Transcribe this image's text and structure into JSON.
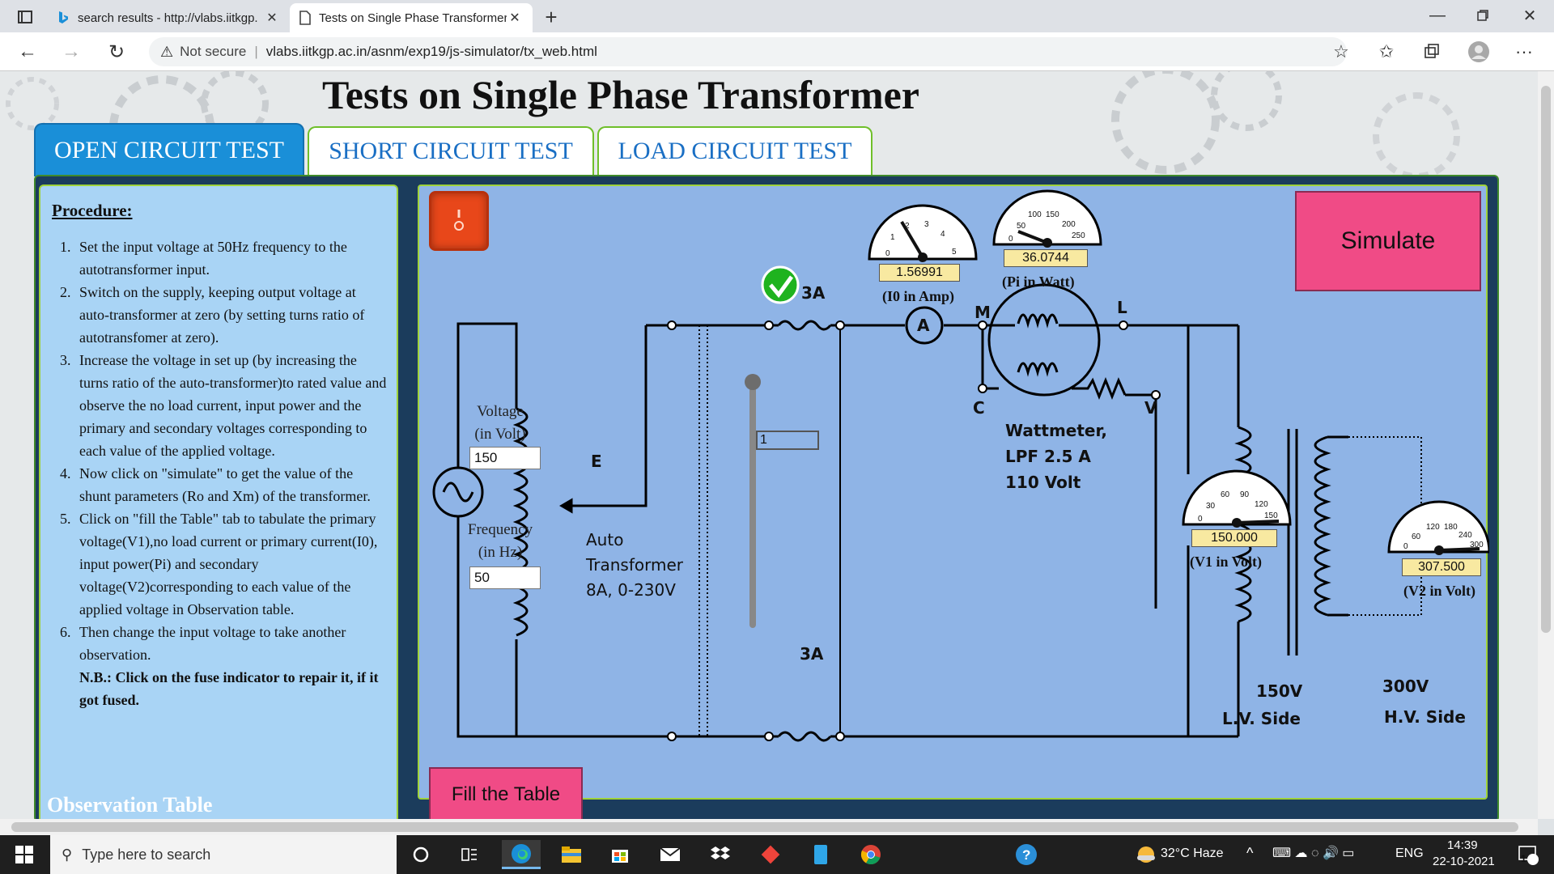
{
  "browser": {
    "tabs": [
      {
        "label": "search results - http://vlabs.iitkgp.",
        "active": false
      },
      {
        "label": "Tests on Single Phase Transformer",
        "active": true
      }
    ],
    "security_label": "Not secure",
    "url": "vlabs.iitkgp.ac.in/asnm/exp19/js-simulator/tx_web.html"
  },
  "page": {
    "title": "Tests on Single Phase Transformer",
    "test_tabs": [
      "OPEN CIRCUIT TEST",
      "SHORT CIRCUIT TEST",
      "LOAD CIRCUIT TEST"
    ],
    "active_test_tab": 0
  },
  "procedure": {
    "heading": "Procedure:",
    "steps": [
      "Set the input voltage at 50Hz frequency to the autotransformer input.",
      "Switch on the supply, keeping output voltage at auto-transformer at zero (by setting turns ratio of autotransfomer at zero).",
      "Increase the voltage in set up (by increasing the turns ratio of the auto-transformer)to rated value and observe the no load current, input power and the primary and secondary voltages corresponding to each value of the applied voltage.",
      "Now click on \"simulate\" to get the value of the shunt parameters (Ro and Xm) of the transformer.",
      "Click on \"fill the Table\" tab to tabulate the primary voltage(V1),no load current or primary current(I0), input power(Pi) and secondary voltage(V2)corresponding to each value of the applied voltage in Observation table.",
      "Then change the input voltage to take another observation."
    ],
    "note": "N.B.: Click on the fuse indicator to repair it, if it got fused."
  },
  "observation_title": "Observation Table",
  "simulator": {
    "simulate_label": "Simulate",
    "fill_table_label": "Fill the Table",
    "voltage_label_1": "Voltage",
    "voltage_label_2": "(in Volt)",
    "voltage_value": "150",
    "frequency_label_1": "Frequency",
    "frequency_label_2": "(in Hz)",
    "frequency_value": "50",
    "turns_ratio_value": "1",
    "meters": {
      "i0": {
        "value": "1.56991",
        "label": "(I0 in Amp)",
        "ticks": [
          "0",
          "1",
          "2",
          "3",
          "4",
          "5"
        ]
      },
      "pi": {
        "value": "36.0744",
        "label": "(Pi in Watt)",
        "ticks": [
          "0",
          "50",
          "100",
          "150",
          "200",
          "250"
        ]
      },
      "v1": {
        "value": "150.000",
        "label": "(V1 in Volt)",
        "ticks": [
          "0",
          "30",
          "60",
          "90",
          "120",
          "150"
        ]
      },
      "v2": {
        "value": "307.500",
        "label": "(V2 in Volt)",
        "ticks": [
          "0",
          "60",
          "120",
          "180",
          "240",
          "300"
        ]
      }
    },
    "labels": {
      "fuse_top": "3A",
      "fuse_bottom": "3A",
      "ammeter": "A",
      "source_e": "E",
      "wm_m": "M",
      "wm_l": "L",
      "wm_c": "C",
      "wm_v": "V",
      "wattmeter_1": "Wattmeter,",
      "wattmeter_2": "LPF 2.5 A",
      "wattmeter_3": "110 Volt",
      "auto_1": "Auto",
      "auto_2": "Transformer",
      "auto_3": "8A, 0-230V",
      "lv_voltage": "150V",
      "lv_side": "L.V.  Side",
      "hv_voltage": "300V",
      "hv_side": "H.V.  Side"
    }
  },
  "taskbar": {
    "search_placeholder": "Type here to search",
    "weather": "32°C  Haze",
    "language": "ENG",
    "time": "14:39",
    "date": "22-10-2021",
    "notification_count": "1"
  }
}
